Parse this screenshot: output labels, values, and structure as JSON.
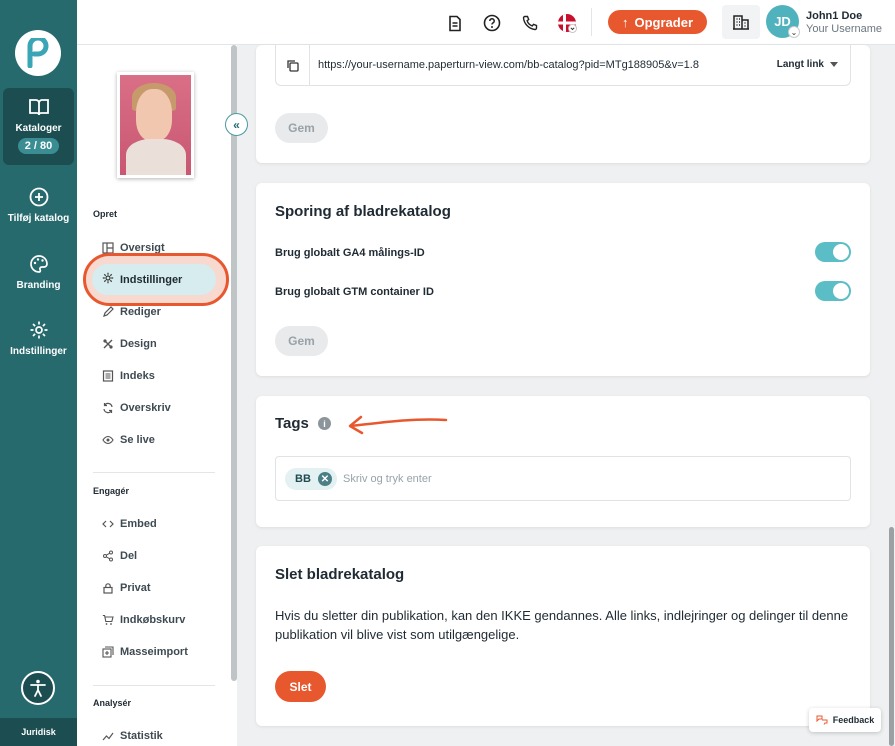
{
  "rail": {
    "logo_letter": "P",
    "catalogs_label": "Kataloger",
    "catalogs_count": "2 / 80",
    "add_catalog_label": "Tilføj katalog",
    "branding_label": "Branding",
    "settings_label": "Indstillinger",
    "legal_label": "Juridisk"
  },
  "topbar": {
    "icons": [
      "document-icon",
      "help-icon",
      "phone-icon",
      "denmark-flag-icon"
    ],
    "upgrade_label": "Opgrader",
    "user_initials": "JD",
    "user_name": "John1 Doe",
    "user_username": "Your Username"
  },
  "sidebar": {
    "section_create": "Opret",
    "create_items": [
      {
        "label": "Oversigt",
        "icon": "overview-icon"
      },
      {
        "label": "Indstillinger",
        "icon": "gear-icon"
      },
      {
        "label": "Rediger",
        "icon": "pencil-icon"
      },
      {
        "label": "Design",
        "icon": "design-icon"
      },
      {
        "label": "Indeks",
        "icon": "index-icon"
      },
      {
        "label": "Overskriv",
        "icon": "refresh-icon"
      },
      {
        "label": "Se live",
        "icon": "eye-icon"
      }
    ],
    "section_engage": "Engagér",
    "engage_items": [
      {
        "label": "Embed",
        "icon": "code-icon"
      },
      {
        "label": "Del",
        "icon": "share-icon"
      },
      {
        "label": "Privat",
        "icon": "lock-icon"
      },
      {
        "label": "Indkøbskurv",
        "icon": "cart-icon"
      },
      {
        "label": "Masseimport",
        "icon": "import-icon"
      }
    ],
    "section_analyze": "Analysér",
    "analyze_items": [
      {
        "label": "Statistik",
        "icon": "chart-icon"
      }
    ],
    "collapse_glyph": "«"
  },
  "link_card": {
    "url": "https://your-username.paperturn-view.com/bb-catalog?pid=MTg188905&v=1.8",
    "link_type": "Langt link",
    "save_label": "Gem"
  },
  "tracking_card": {
    "title": "Sporing af bladrekatalog",
    "ga4_label": "Brug globalt GA4 målings-ID",
    "ga4_enabled": true,
    "gtm_label": "Brug globalt GTM container ID",
    "gtm_enabled": true,
    "save_label": "Gem"
  },
  "tags_card": {
    "title": "Tags",
    "info_glyph": "i",
    "tags": [
      "BB"
    ],
    "placeholder": "Skriv og tryk enter"
  },
  "delete_card": {
    "title": "Slet bladrekatalog",
    "description": "Hvis du sletter din publikation, kan den IKKE gendannes. Alle links, indlejringer og delinger til denne publikation vil blive vist som utilgængelige.",
    "delete_label": "Slet"
  },
  "feedback_label": "Feedback",
  "colors": {
    "rail": "#266a6e",
    "accent": "#e8582f",
    "toggle_on": "#5bbdc6"
  }
}
